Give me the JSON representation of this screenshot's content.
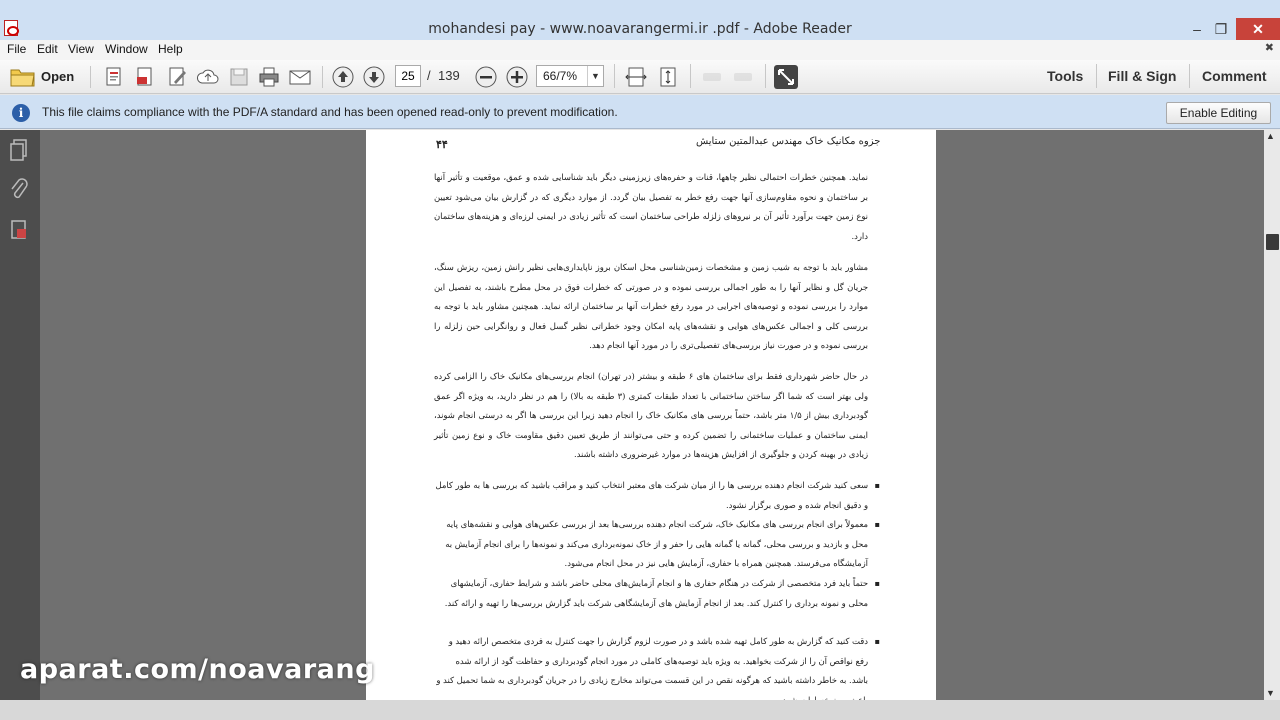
{
  "window": {
    "title": "mohandesi pay - www.noavarangermi.ir .pdf - Adobe Reader",
    "minimize": "–",
    "maximize": "❐",
    "close": "✕"
  },
  "menu": {
    "items": [
      "File",
      "Edit",
      "View",
      "Window",
      "Help"
    ],
    "collapse": "✖"
  },
  "toolbar": {
    "open_label": "Open",
    "page_current": "25",
    "page_separator": "/",
    "page_total": "139",
    "zoom": "66/7%",
    "zoom_arrow": "▼",
    "tools_label": "Tools",
    "fill_sign_label": "Fill & Sign",
    "comment_label": "Comment"
  },
  "infobar": {
    "icon": "i",
    "message": "This file claims compliance with the PDF/A standard and has been opened read-only to prevent modification.",
    "enable_editing": "Enable Editing"
  },
  "document": {
    "header": "جزوه مکانیک خاک مهندس عبدالمتین ستایش",
    "page_number": "۴۴",
    "paragraphs": [
      "نماید. همچنین خطرات احتمالی نظیر چاهها، قنات و حفره‌های زیرزمینی دیگر باید شناسایی شده و عمق، موقعیت و تأثیر آنها بر ساختمان و نحوه مقاوم‌سازی آنها جهت رفع خطر به تفصیل بیان گردد. از موارد دیگری که در گزارش بیان می‌شود تعیین نوع زمین جهت برآورد تأثیر آن بر نیروهای زلزله طراحی ساختمان است که تأثیر زیادی در ایمنی لرزه‌ای و هزینه‌های ساختمان دارد.",
      "مشاور باید با توجه به شیب زمین و مشخصات زمین‌شناسی محل اسکان بروز ناپایداری‌هایی نظیر رانش زمین، ریزش سنگ، جریان گل و نظایر آنها را به طور اجمالی بررسی نموده و در صورتی که خطرات فوق در محل مطرح باشند، به تفصیل این موارد را بررسی نموده و توصیه‌های اجرایی در مورد رفع خطرات آنها بر ساختمان ارائه نماید. همچنین مشاور باید با توجه به بررسی کلی و اجمالی عکس‌های هوایی و نقشه‌های پایه امکان وجود خطراتی نظیر گسل فعال و روانگرایی حین زلزله را بررسی نموده و در صورت نیاز بررسی‌های تفصیلی‌تری را در مورد آنها انجام دهد.",
      "در حال حاضر شهرداری فقط برای ساختمان های ۶ طبقه و بیشتر (در تهران) انجام بررسی‌های مکانیک خاک را الزامی کرده ولی بهتر است که شما اگر ساختن ساختمانی با تعداد طبقات کمتری (۳ طبقه به بالا) را هم در نظر دارید، به ویژه اگر عمق گودبرداری بیش از ۱/۵ متر باشد، حتماً بررسی های مکانیک خاک را انجام دهید زیرا این بررسی ها اگر به درستی انجام شوند، ایمنی ساختمان و عملیات ساختمانی را تضمین کرده و حتی می‌توانند از طریق تعیین دقیق مقاومت خاک و نوع زمین تأثیر زیادی در بهینه کردن و جلوگیری از افزایش هزینه‌ها در موارد غیرضروری داشته باشند."
    ],
    "bullets": [
      "سعی کنید شرکت انجام دهنده بررسی ها را از میان شرکت های معتبر انتخاب کنید و مراقب باشید که بررسی ها به طور کامل و دقیق انجام شده و صوری برگزار نشود.",
      "معمولاً برای انجام بررسی های مکانیک خاک، شرکت انجام دهنده بررسی‌ها بعد از بررسی عکس‌های هوایی و نقشه‌های پایه محل و بازدید و بررسی محلی، گمانه یا گمانه هایی را حفر و از خاک نمونه‌برداری می‌کند و نمونه‌ها را برای انجام آزمایش به آزمایشگاه می‌فرستد. همچنین همراه با حفاری، آزمایش هایی نیز در محل انجام می‌شود.",
      "حتماً باید فرد متخصصی از شرکت در هنگام حفاری ها و انجام آزمایش‌های محلی حاضر باشد و شرایط حفاری، آزمایشهای محلی و نمونه برداری را کنترل کند. بعد از انجام آزمایش های آزمایشگاهی شرکت باید گزارش بررسی‌ها را تهیه و ارائه کند.",
      "دقت کنید که گزارش به طور کامل تهیه شده باشد و در صورت لزوم گزارش را جهت کنترل به فردی متخصص ارائه دهید و رفع نواقص آن را از شرکت بخواهید. به ویژه باید توصیه‌های کاملی در مورد انجام گودبرداری و حفاظت گود از ارائه شده باشد. به خاطر داشته باشید که هرگونه نقص در این قسمت می‌تواند مخارج زیادی را در جریان گودبرداری به شما تحمیل کند و باعث بروز خسارات شود."
    ]
  },
  "watermark": "aparat.com/noavarang",
  "scroll": {
    "up": "▲",
    "down": "▼",
    "position_fraction": 0.17
  }
}
